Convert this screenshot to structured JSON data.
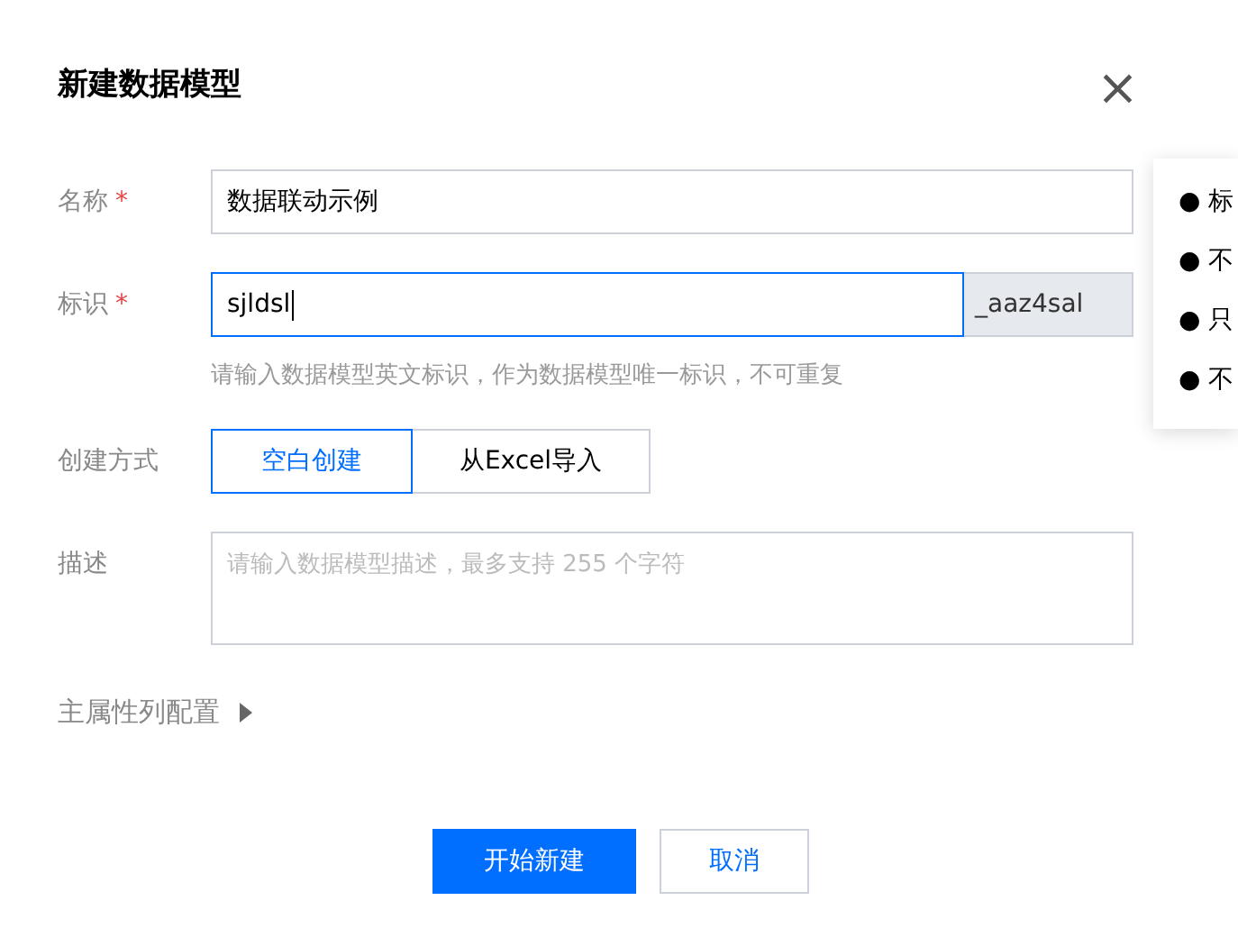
{
  "dialog": {
    "title": "新建数据模型",
    "close": "×"
  },
  "fields": [
    {
      "kind": "text",
      "label": "名称",
      "required": true,
      "value": "数据联动示例",
      "focused": false
    },
    {
      "kind": "suffix",
      "label": "标识",
      "required": true,
      "value": "sjldsl",
      "focused": true,
      "suffix": "_aaz4sal",
      "hint": "请输入数据模型英文标识，作为数据模型唯一标识，不可重复"
    },
    {
      "kind": "choice",
      "label": "创建方式",
      "required": false,
      "options": [
        {
          "label": "空白创建",
          "selected": true
        },
        {
          "label": "从Excel导入",
          "selected": false
        }
      ]
    },
    {
      "kind": "textarea",
      "label": "描述",
      "required": false,
      "placeholder": "请输入数据模型描述，最多支持 255 个字符"
    }
  ],
  "expander": {
    "label": "主属性列配置",
    "expanded": false
  },
  "buttons": [
    {
      "label": "开始新建",
      "kind": "primary"
    },
    {
      "label": "取消",
      "kind": "secondary"
    }
  ],
  "tooltip": {
    "items": [
      "● 标",
      "● 不",
      "● 只",
      "● 不"
    ]
  },
  "required_mark": "*"
}
